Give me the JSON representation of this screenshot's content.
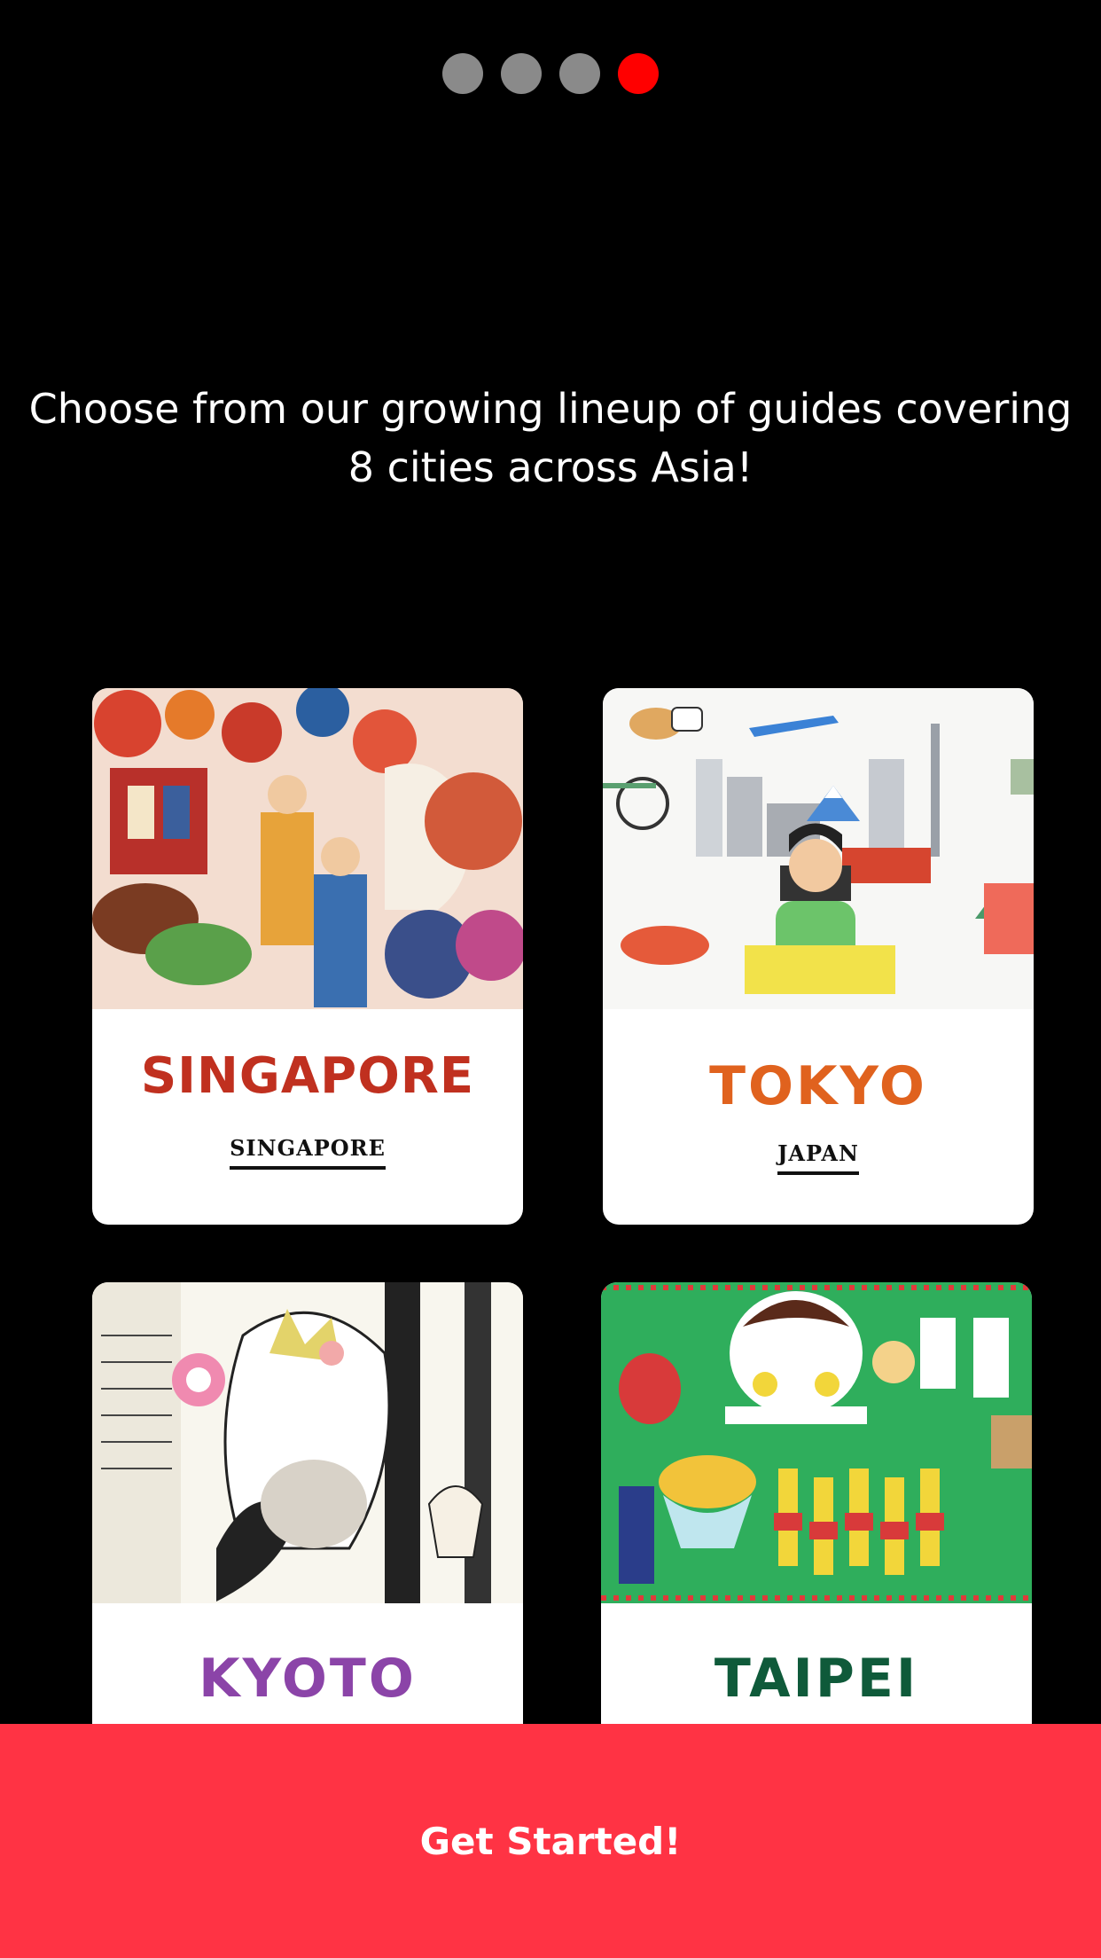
{
  "pager": {
    "total": 4,
    "active_index": 3
  },
  "tagline": "Choose from our growing lineup of guides covering 8 cities across Asia!",
  "guides": [
    {
      "city": "SINGAPORE",
      "country": "SINGAPORE",
      "city_color": "#c0301f"
    },
    {
      "city": "TOKYO",
      "country": "JAPAN",
      "city_color": "#e0621e"
    },
    {
      "city": "KYOTO",
      "country": "",
      "city_color": "#8b44a8"
    },
    {
      "city": "TAIPEI",
      "country": "",
      "city_color": "#0f5a3a"
    }
  ],
  "cta": {
    "label": "Get Started!"
  },
  "colors": {
    "accent": "#ff3344",
    "active_dot": "#ff0000",
    "inactive_dot": "#8a8a8a"
  }
}
